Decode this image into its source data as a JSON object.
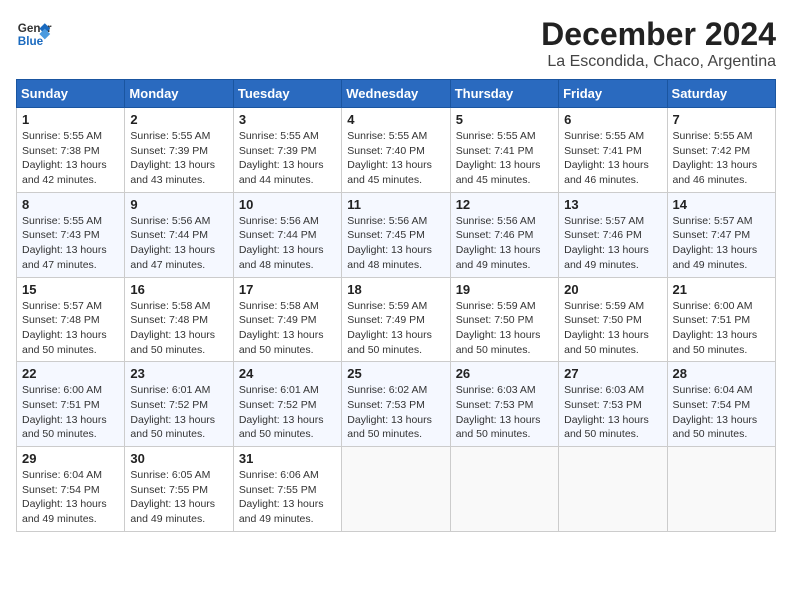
{
  "header": {
    "logo_line1": "General",
    "logo_line2": "Blue",
    "title": "December 2024",
    "subtitle": "La Escondida, Chaco, Argentina"
  },
  "calendar": {
    "days_of_week": [
      "Sunday",
      "Monday",
      "Tuesday",
      "Wednesday",
      "Thursday",
      "Friday",
      "Saturday"
    ],
    "weeks": [
      [
        null,
        null,
        null,
        null,
        null,
        null,
        null
      ]
    ],
    "cells": [
      {
        "day": 1,
        "col": 0,
        "sunrise": "5:55 AM",
        "sunset": "7:38 PM",
        "daylight": "13 hours and 42 minutes."
      },
      {
        "day": 2,
        "col": 1,
        "sunrise": "5:55 AM",
        "sunset": "7:39 PM",
        "daylight": "13 hours and 43 minutes."
      },
      {
        "day": 3,
        "col": 2,
        "sunrise": "5:55 AM",
        "sunset": "7:39 PM",
        "daylight": "13 hours and 44 minutes."
      },
      {
        "day": 4,
        "col": 3,
        "sunrise": "5:55 AM",
        "sunset": "7:40 PM",
        "daylight": "13 hours and 45 minutes."
      },
      {
        "day": 5,
        "col": 4,
        "sunrise": "5:55 AM",
        "sunset": "7:41 PM",
        "daylight": "13 hours and 45 minutes."
      },
      {
        "day": 6,
        "col": 5,
        "sunrise": "5:55 AM",
        "sunset": "7:41 PM",
        "daylight": "13 hours and 46 minutes."
      },
      {
        "day": 7,
        "col": 6,
        "sunrise": "5:55 AM",
        "sunset": "7:42 PM",
        "daylight": "13 hours and 46 minutes."
      },
      {
        "day": 8,
        "col": 0,
        "sunrise": "5:55 AM",
        "sunset": "7:43 PM",
        "daylight": "13 hours and 47 minutes."
      },
      {
        "day": 9,
        "col": 1,
        "sunrise": "5:56 AM",
        "sunset": "7:44 PM",
        "daylight": "13 hours and 47 minutes."
      },
      {
        "day": 10,
        "col": 2,
        "sunrise": "5:56 AM",
        "sunset": "7:44 PM",
        "daylight": "13 hours and 48 minutes."
      },
      {
        "day": 11,
        "col": 3,
        "sunrise": "5:56 AM",
        "sunset": "7:45 PM",
        "daylight": "13 hours and 48 minutes."
      },
      {
        "day": 12,
        "col": 4,
        "sunrise": "5:56 AM",
        "sunset": "7:46 PM",
        "daylight": "13 hours and 49 minutes."
      },
      {
        "day": 13,
        "col": 5,
        "sunrise": "5:57 AM",
        "sunset": "7:46 PM",
        "daylight": "13 hours and 49 minutes."
      },
      {
        "day": 14,
        "col": 6,
        "sunrise": "5:57 AM",
        "sunset": "7:47 PM",
        "daylight": "13 hours and 49 minutes."
      },
      {
        "day": 15,
        "col": 0,
        "sunrise": "5:57 AM",
        "sunset": "7:48 PM",
        "daylight": "13 hours and 50 minutes."
      },
      {
        "day": 16,
        "col": 1,
        "sunrise": "5:58 AM",
        "sunset": "7:48 PM",
        "daylight": "13 hours and 50 minutes."
      },
      {
        "day": 17,
        "col": 2,
        "sunrise": "5:58 AM",
        "sunset": "7:49 PM",
        "daylight": "13 hours and 50 minutes."
      },
      {
        "day": 18,
        "col": 3,
        "sunrise": "5:59 AM",
        "sunset": "7:49 PM",
        "daylight": "13 hours and 50 minutes."
      },
      {
        "day": 19,
        "col": 4,
        "sunrise": "5:59 AM",
        "sunset": "7:50 PM",
        "daylight": "13 hours and 50 minutes."
      },
      {
        "day": 20,
        "col": 5,
        "sunrise": "5:59 AM",
        "sunset": "7:50 PM",
        "daylight": "13 hours and 50 minutes."
      },
      {
        "day": 21,
        "col": 6,
        "sunrise": "6:00 AM",
        "sunset": "7:51 PM",
        "daylight": "13 hours and 50 minutes."
      },
      {
        "day": 22,
        "col": 0,
        "sunrise": "6:00 AM",
        "sunset": "7:51 PM",
        "daylight": "13 hours and 50 minutes."
      },
      {
        "day": 23,
        "col": 1,
        "sunrise": "6:01 AM",
        "sunset": "7:52 PM",
        "daylight": "13 hours and 50 minutes."
      },
      {
        "day": 24,
        "col": 2,
        "sunrise": "6:01 AM",
        "sunset": "7:52 PM",
        "daylight": "13 hours and 50 minutes."
      },
      {
        "day": 25,
        "col": 3,
        "sunrise": "6:02 AM",
        "sunset": "7:53 PM",
        "daylight": "13 hours and 50 minutes."
      },
      {
        "day": 26,
        "col": 4,
        "sunrise": "6:03 AM",
        "sunset": "7:53 PM",
        "daylight": "13 hours and 50 minutes."
      },
      {
        "day": 27,
        "col": 5,
        "sunrise": "6:03 AM",
        "sunset": "7:53 PM",
        "daylight": "13 hours and 50 minutes."
      },
      {
        "day": 28,
        "col": 6,
        "sunrise": "6:04 AM",
        "sunset": "7:54 PM",
        "daylight": "13 hours and 50 minutes."
      },
      {
        "day": 29,
        "col": 0,
        "sunrise": "6:04 AM",
        "sunset": "7:54 PM",
        "daylight": "13 hours and 49 minutes."
      },
      {
        "day": 30,
        "col": 1,
        "sunrise": "6:05 AM",
        "sunset": "7:55 PM",
        "daylight": "13 hours and 49 minutes."
      },
      {
        "day": 31,
        "col": 2,
        "sunrise": "6:06 AM",
        "sunset": "7:55 PM",
        "daylight": "13 hours and 49 minutes."
      }
    ]
  }
}
